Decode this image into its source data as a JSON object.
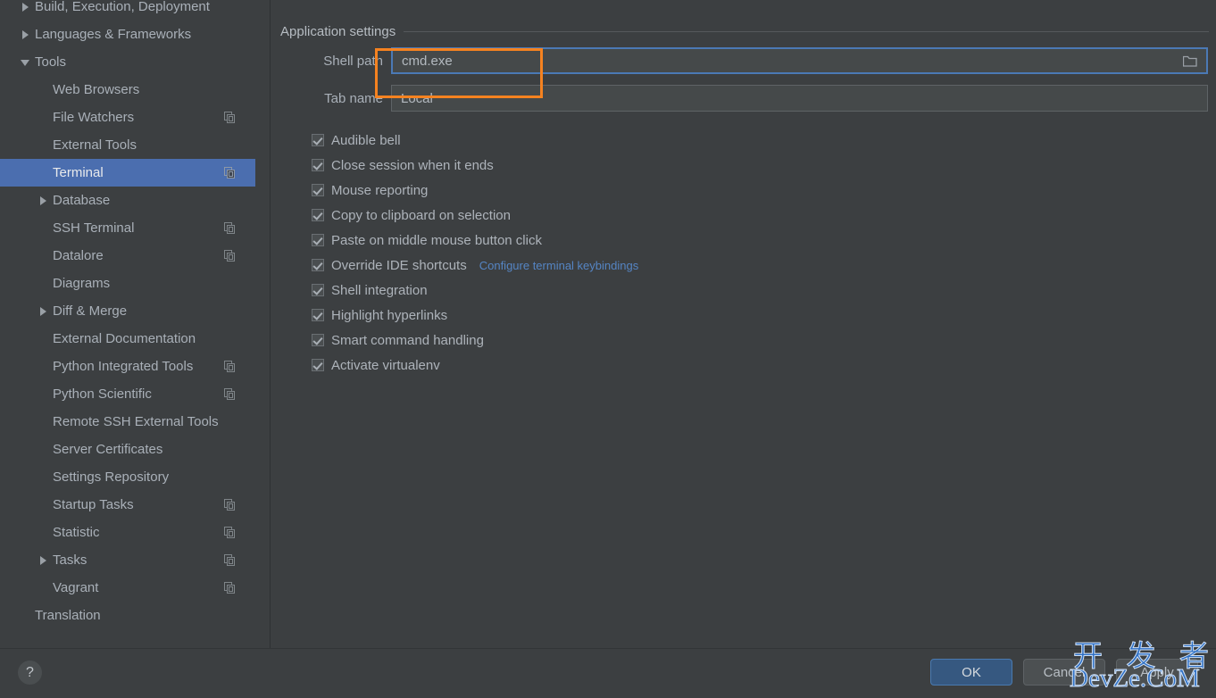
{
  "sidebar": {
    "items": [
      {
        "label": "Build, Execution, Deployment",
        "indent": 1,
        "arrow": "right",
        "badge": false,
        "selected": false,
        "clipped_top": false
      },
      {
        "label": "Languages & Frameworks",
        "indent": 1,
        "arrow": "right",
        "badge": false,
        "selected": false
      },
      {
        "label": "Tools",
        "indent": 1,
        "arrow": "down",
        "badge": false,
        "selected": false
      },
      {
        "label": "Web Browsers",
        "indent": 2,
        "arrow": "none",
        "badge": false,
        "selected": false
      },
      {
        "label": "File Watchers",
        "indent": 2,
        "arrow": "none",
        "badge": true,
        "selected": false
      },
      {
        "label": "External Tools",
        "indent": 2,
        "arrow": "none",
        "badge": false,
        "selected": false
      },
      {
        "label": "Terminal",
        "indent": 2,
        "arrow": "none",
        "badge": true,
        "selected": true
      },
      {
        "label": "Database",
        "indent": 2,
        "arrow": "right",
        "badge": false,
        "selected": false
      },
      {
        "label": "SSH Terminal",
        "indent": 2,
        "arrow": "none",
        "badge": true,
        "selected": false
      },
      {
        "label": "Datalore",
        "indent": 2,
        "arrow": "none",
        "badge": true,
        "selected": false
      },
      {
        "label": "Diagrams",
        "indent": 2,
        "arrow": "none",
        "badge": false,
        "selected": false
      },
      {
        "label": "Diff & Merge",
        "indent": 2,
        "arrow": "right",
        "badge": false,
        "selected": false
      },
      {
        "label": "External Documentation",
        "indent": 2,
        "arrow": "none",
        "badge": false,
        "selected": false
      },
      {
        "label": "Python Integrated Tools",
        "indent": 2,
        "arrow": "none",
        "badge": true,
        "selected": false
      },
      {
        "label": "Python Scientific",
        "indent": 2,
        "arrow": "none",
        "badge": true,
        "selected": false
      },
      {
        "label": "Remote SSH External Tools",
        "indent": 2,
        "arrow": "none",
        "badge": false,
        "selected": false
      },
      {
        "label": "Server Certificates",
        "indent": 2,
        "arrow": "none",
        "badge": false,
        "selected": false
      },
      {
        "label": "Settings Repository",
        "indent": 2,
        "arrow": "none",
        "badge": false,
        "selected": false
      },
      {
        "label": "Startup Tasks",
        "indent": 2,
        "arrow": "none",
        "badge": true,
        "selected": false
      },
      {
        "label": "Statistic",
        "indent": 2,
        "arrow": "none",
        "badge": true,
        "selected": false
      },
      {
        "label": "Tasks",
        "indent": 2,
        "arrow": "right",
        "badge": true,
        "selected": false
      },
      {
        "label": "Vagrant",
        "indent": 2,
        "arrow": "none",
        "badge": true,
        "selected": false
      },
      {
        "label": "Translation",
        "indent": 1,
        "arrow": "none",
        "badge": false,
        "selected": false
      }
    ]
  },
  "main": {
    "section_title": "Application settings",
    "fields": [
      {
        "label": "Shell path",
        "value": "cmd.exe",
        "focused": true,
        "has_browse": true
      },
      {
        "label": "Tab name",
        "value": "Local",
        "focused": false,
        "has_browse": false
      }
    ],
    "checkboxes": [
      {
        "label": "Audible bell",
        "checked": true,
        "link": null
      },
      {
        "label": "Close session when it ends",
        "checked": true,
        "link": null
      },
      {
        "label": "Mouse reporting",
        "checked": true,
        "link": null
      },
      {
        "label": "Copy to clipboard on selection",
        "checked": true,
        "link": null
      },
      {
        "label": "Paste on middle mouse button click",
        "checked": true,
        "link": null
      },
      {
        "label": "Override IDE shortcuts",
        "checked": true,
        "link": "Configure terminal keybindings"
      },
      {
        "label": "Shell integration",
        "checked": true,
        "link": null
      },
      {
        "label": "Highlight hyperlinks",
        "checked": true,
        "link": null
      },
      {
        "label": "Smart command handling",
        "checked": true,
        "link": null
      },
      {
        "label": "Activate virtualenv",
        "checked": true,
        "link": null
      }
    ]
  },
  "bottom_bar": {
    "help_glyph": "?",
    "buttons": [
      {
        "id": "ok",
        "label": "OK"
      },
      {
        "id": "cancel",
        "label": "Cancel"
      },
      {
        "id": "apply",
        "label": "Apply"
      }
    ]
  },
  "watermark": {
    "chinese": "开 发 者",
    "latin": "DevZe.CoM"
  },
  "colors": {
    "background": "#3c3f41",
    "selection_blue": "#4b6eaf",
    "accent_orange": "#f58220",
    "link_blue": "#5585c4",
    "focus_border": "#4b79b5",
    "ok_button": "#365880",
    "text": "#a9b0b8",
    "watermark_blue": "#2e6fc4"
  }
}
